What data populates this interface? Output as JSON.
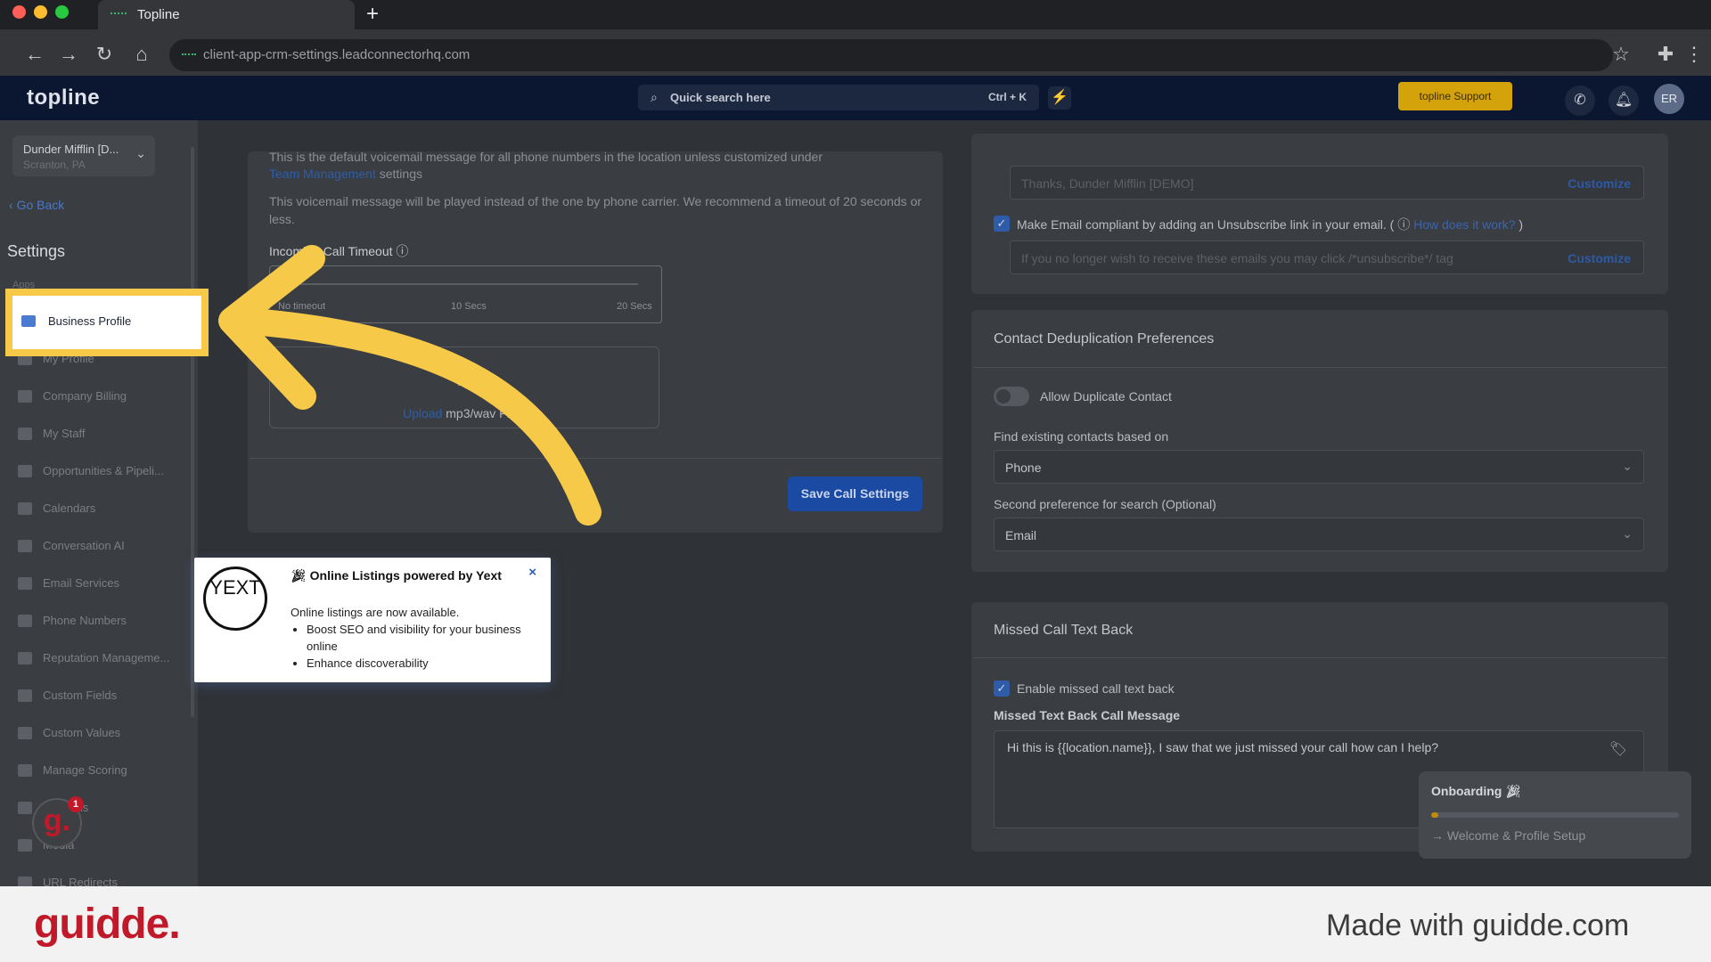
{
  "browser": {
    "tab_title": "Topline",
    "url": "client-app-crm-settings.leadconnectorhq.com"
  },
  "header": {
    "logo": "topline",
    "search_label": "Quick search here",
    "search_shortcut": "Ctrl + K",
    "support_button": "topline Support",
    "avatar_initials": "ER"
  },
  "sidebar": {
    "location_name": "Dunder Mifflin [D...",
    "location_city": "Scranton, PA",
    "go_back": "Go Back",
    "heading": "Settings",
    "section": "Apps",
    "highlighted_item": "Business Profile",
    "items": [
      "My Profile",
      "Company Billing",
      "My Staff",
      "Opportunities & Pipeli...",
      "Calendars",
      "Conversation AI",
      "Email Services",
      "Phone Numbers",
      "Reputation Manageme...",
      "Custom Fields",
      "Custom Values",
      "Manage Scoring",
      "Domains",
      "Media",
      "URL Redirects"
    ],
    "badge_letter": "g.",
    "badge_count": "1"
  },
  "call_settings": {
    "line1": "This is the default voicemail message for all phone numbers in the location unless customized under",
    "team_management_link": "Team Management",
    "line1_suffix": "settings",
    "line2": "This voicemail message will be played instead of the one by phone carrier. We recommend a timeout of 20 seconds or less.",
    "timeout_label": "Incoming Call Timeout",
    "slider_labels": [
      "No timeout",
      "10 Secs",
      "20 Secs"
    ],
    "upload_link": "Upload",
    "upload_suffix": "mp3/wav File",
    "save_button": "Save Call Settings"
  },
  "email_settings": {
    "sender_placeholder": "Thanks, Dunder Mifflin [DEMO]",
    "customize": "Customize",
    "compliant_label": "Make Email compliant by adding an Unsubscribe link in your email.",
    "how_link": "How does it work?",
    "unsubscribe_placeholder": "If you no longer wish to receive these emails you may click /*unsubscribe*/ tag"
  },
  "dedup": {
    "title": "Contact Deduplication Preferences",
    "allow_duplicate": "Allow Duplicate Contact",
    "find_label": "Find existing contacts based on",
    "find_value": "Phone",
    "second_label": "Second preference for search (Optional)",
    "second_value": "Email"
  },
  "missed_call": {
    "title": "Missed Call Text Back",
    "enable_label": "Enable missed call text back",
    "message_label": "Missed Text Back Call Message",
    "message_value": "Hi this is {{location.name}}, I saw that we just missed your call how can I help?"
  },
  "popup": {
    "logo_text": "YEXT",
    "title": "Online Listings powered by Yext",
    "intro": "Online listings are now available.",
    "bullets": [
      "Boost SEO and visibility for your business online",
      "Enhance discoverability"
    ]
  },
  "onboarding": {
    "title": "Onboarding",
    "progress": 0.03,
    "step": "Welcome & Profile Setup"
  },
  "footer": {
    "logo": "guidde.",
    "made_with": "Made with guidde.com"
  }
}
